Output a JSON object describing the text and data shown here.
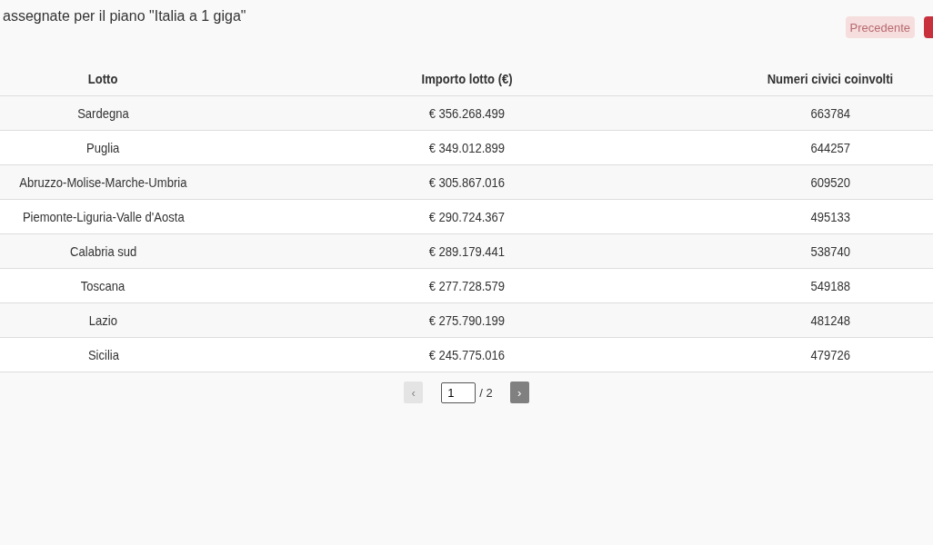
{
  "title": "assegnate per il piano \"Italia a 1 giga\"",
  "nav_buttons": [
    {
      "label": "Precedente",
      "disabled": true
    },
    {
      "disabled": false
    }
  ],
  "table": {
    "columns": [
      "Lotto",
      "Importo lotto (€)",
      "Numeri civici coinvolti"
    ],
    "rows": [
      [
        "Sardegna",
        "€ 356.268.499",
        "663784"
      ],
      [
        "Puglia",
        "€ 349.012.899",
        "644257"
      ],
      [
        "Abruzzo-Molise-Marche-Umbria",
        "€ 305.867.016",
        "609520"
      ],
      [
        "Piemonte-Liguria-Valle d'Aosta",
        "€ 290.724.367",
        "495133"
      ],
      [
        "Calabria sud",
        "€ 289.179.441",
        "538740"
      ],
      [
        "Toscana",
        "€ 277.728.579",
        "549188"
      ],
      [
        "Lazio",
        "€ 275.790.199",
        "481248"
      ],
      [
        "Sicilia",
        "€ 245.775.016",
        "479726"
      ]
    ]
  },
  "pagination": {
    "prev": {
      "label": "‹",
      "disabled": true
    },
    "page": "1",
    "total": "/ 2",
    "next": {
      "label": "›",
      "disabled": false
    }
  }
}
